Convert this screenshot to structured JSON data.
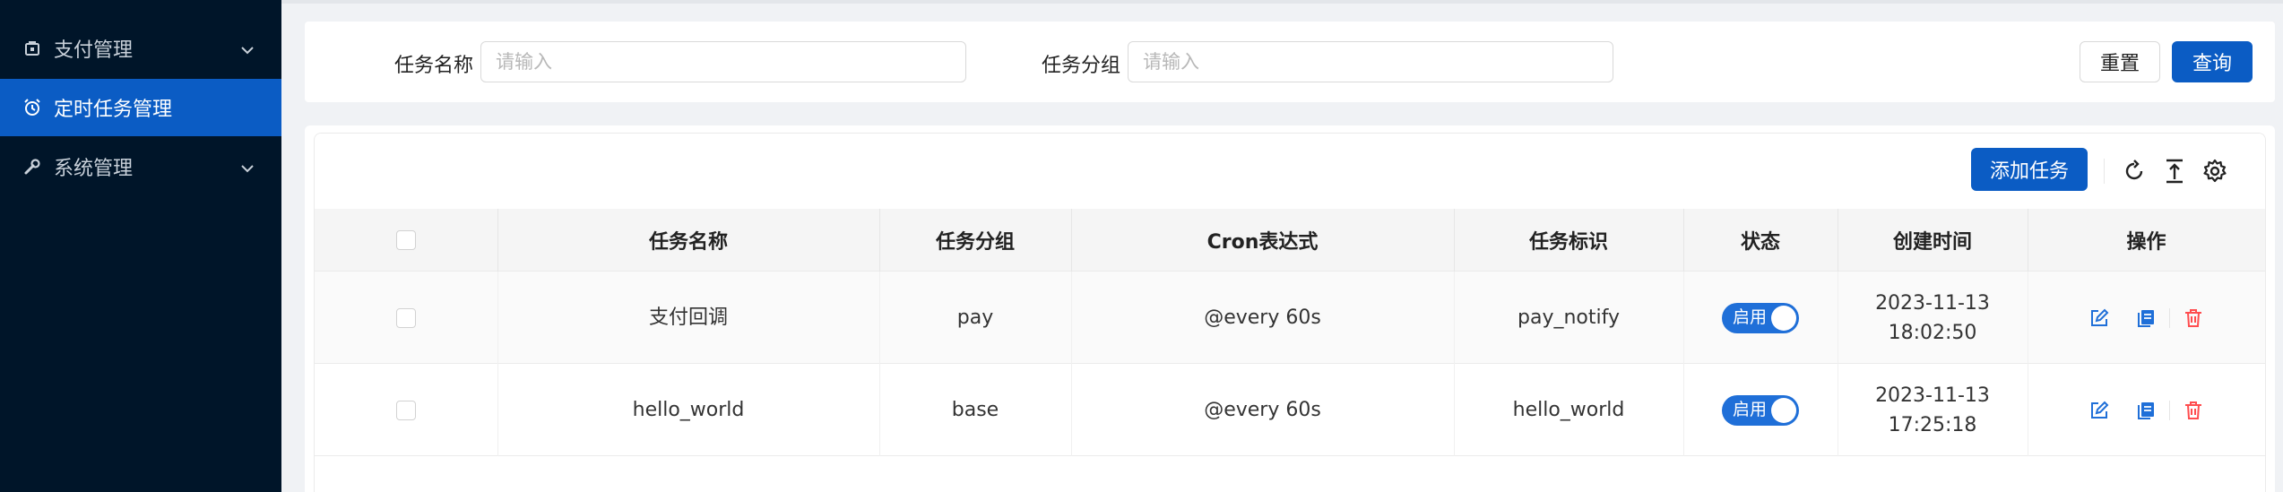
{
  "sidebar": {
    "items": [
      {
        "label": "支付管理",
        "icon": "wallet-icon",
        "expandable": true
      },
      {
        "label": "定时任务管理",
        "icon": "alarm-clock-icon",
        "active": true
      },
      {
        "label": "系统管理",
        "icon": "wrench-icon",
        "expandable": true
      }
    ]
  },
  "search": {
    "task_name_label": "任务名称",
    "task_name_placeholder": "请输入",
    "task_group_label": "任务分组",
    "task_group_placeholder": "请输入",
    "reset_label": "重置",
    "query_label": "查询"
  },
  "toolbar": {
    "add_label": "添加任务",
    "icons": [
      "refresh-icon",
      "export-icon",
      "settings-icon"
    ]
  },
  "table": {
    "columns": [
      "任务名称",
      "任务分组",
      "Cron表达式",
      "任务标识",
      "状态",
      "创建时间",
      "操作"
    ],
    "rows": [
      {
        "name": "支付回调",
        "group": "pay",
        "cron": "@every 60s",
        "key": "pay_notify",
        "status": "启用",
        "created_date": "2023-11-13",
        "created_time": "18:02:50"
      },
      {
        "name": "hello_world",
        "group": "base",
        "cron": "@every 60s",
        "key": "hello_world",
        "status": "启用",
        "created_date": "2023-11-13",
        "created_time": "17:25:18"
      }
    ]
  },
  "colors": {
    "sidebar_bg": "#001529",
    "primary": "#0b5cc4",
    "switch_on": "#1f6fd8",
    "delete": "#ff4d4f"
  }
}
